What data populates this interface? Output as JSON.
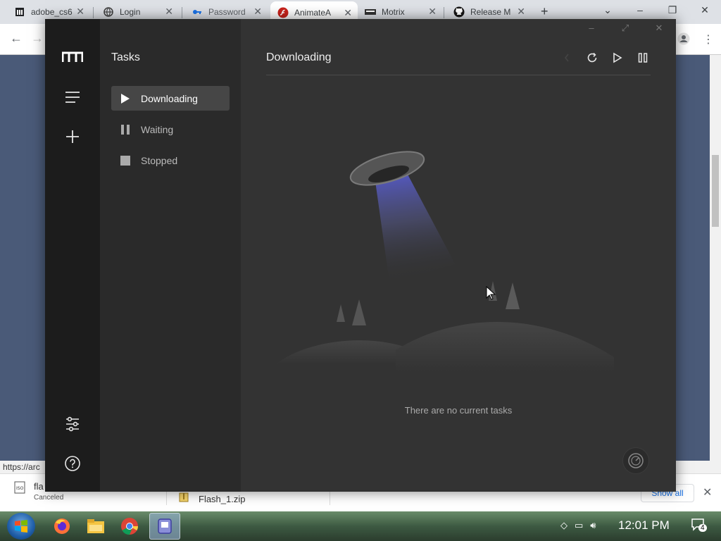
{
  "browser": {
    "tabs": [
      {
        "label": "adobe_cs6",
        "icon": "library-icon"
      },
      {
        "label": "Login",
        "icon": "globe-icon"
      },
      {
        "label": "Password",
        "icon": "key-icon"
      },
      {
        "label": "AnimateA",
        "icon": "flash-icon"
      },
      {
        "label": "Motrix",
        "icon": "motrix-icon"
      },
      {
        "label": "Release M",
        "icon": "github-icon"
      }
    ],
    "status_url": "https://arc"
  },
  "downloads": {
    "items": [
      {
        "name": "fla",
        "status": "Canceled"
      },
      {
        "name": "Flash_1.zip",
        "status": ""
      }
    ],
    "show_all": "Show all"
  },
  "taskbar": {
    "clock": "12:01 PM",
    "notification_count": "4"
  },
  "motrix": {
    "sidebar_title": "Tasks",
    "nav": [
      {
        "label": "Downloading",
        "icon": "play-icon",
        "active": true
      },
      {
        "label": "Waiting",
        "icon": "pause-icon",
        "active": false
      },
      {
        "label": "Stopped",
        "icon": "stop-icon",
        "active": false
      }
    ],
    "main_title": "Downloading",
    "empty_message": "There are no current tasks",
    "accent": "#5a5fd8"
  }
}
